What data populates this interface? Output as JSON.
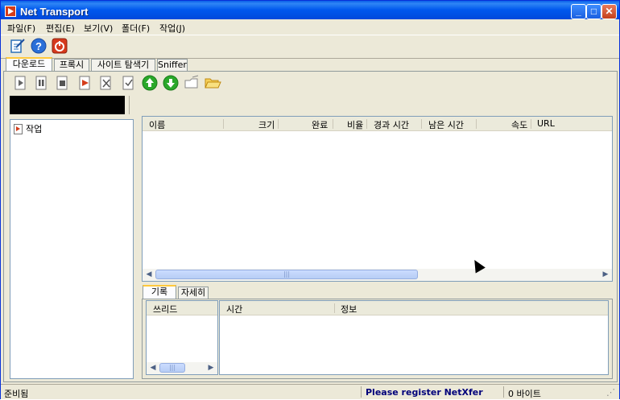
{
  "window": {
    "title": "Net Transport"
  },
  "menu": [
    "파일(F)",
    "편집(E)",
    "보기(V)",
    "폴더(F)",
    "작업(J)"
  ],
  "toolbar1": [
    {
      "icon": "new-download-icon",
      "color": "#2a6fb8"
    },
    {
      "icon": "help-icon",
      "color": "#2a6fd8"
    },
    {
      "icon": "exit-power-icon",
      "color": "#d6391c"
    }
  ],
  "tabs_top": [
    "다운로드",
    "프록시",
    "사이트 탐색기",
    "Sniffer"
  ],
  "toolbar2": [
    {
      "icon": "start-icon",
      "color": "#555555"
    },
    {
      "icon": "pause-icon",
      "color": "#555555"
    },
    {
      "icon": "stop-icon",
      "color": "#555555"
    },
    {
      "icon": "start-all-icon",
      "color": "#d43c1a"
    },
    {
      "icon": "delete-icon",
      "color": "#555555"
    },
    {
      "icon": "mark-complete-icon",
      "color": "#555555"
    },
    {
      "icon": "move-up-icon",
      "color": "#2aa82a"
    },
    {
      "icon": "move-down-icon",
      "color": "#2aa82a"
    },
    {
      "icon": "open-file-icon",
      "color": "#888888"
    },
    {
      "icon": "open-folder-icon",
      "color": "#e8b830"
    }
  ],
  "tree": {
    "root_label": "작업"
  },
  "columns": [
    "이름",
    "크기",
    "완료",
    "비율",
    "경과 시간",
    "남은 시간",
    "속도",
    "URL"
  ],
  "tabs_bottom": [
    "기록",
    "자세히"
  ],
  "log_left_header": "쓰리드",
  "log_right_headers": [
    "시간",
    "정보"
  ],
  "status": {
    "left": "준비됨",
    "register": "Please register NetXfer",
    "bytes": "0 바이트"
  }
}
